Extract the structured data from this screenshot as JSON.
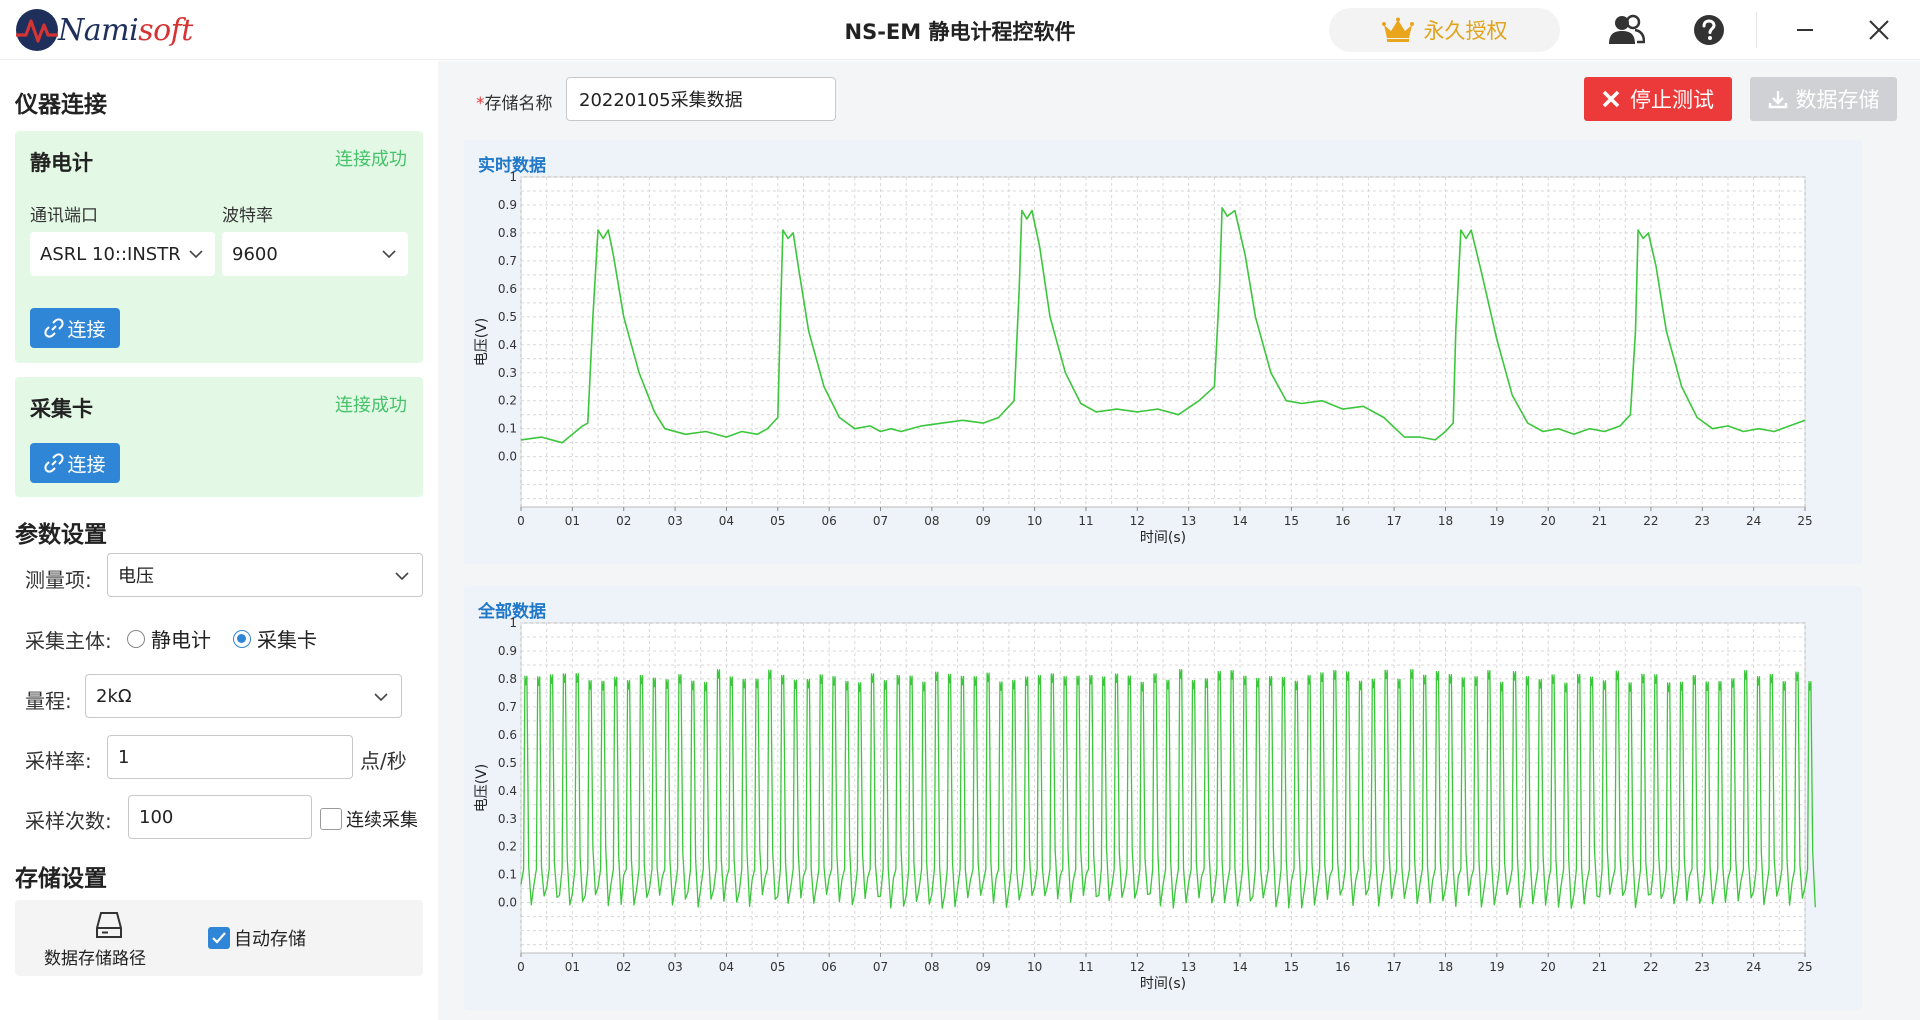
{
  "app": {
    "logo_text_a": "Nami",
    "logo_text_b": "soft",
    "title": "NS-EM 静电计程控软件",
    "license_label": "永久授权"
  },
  "left": {
    "section_connection": "仪器连接",
    "electrometer": {
      "title": "静电计",
      "status": "连接成功",
      "port_label": "通讯端口",
      "port_value": "ASRL 10::INSTR",
      "baud_label": "波特率",
      "baud_value": "9600",
      "connect_label": "连接"
    },
    "daq": {
      "title": "采集卡",
      "status": "连接成功",
      "connect_label": "连接"
    },
    "section_params": "参数设置",
    "params": {
      "measure_label": "测量项:",
      "measure_value": "电压",
      "subject_label": "采集主体:",
      "subject_opt1": "静电计",
      "subject_opt2": "采集卡",
      "subject_selected": "采集卡",
      "range_label": "量程:",
      "range_value": "2kΩ",
      "rate_label": "采样率:",
      "rate_value": "1",
      "rate_unit": "点/秒",
      "count_label": "采样次数:",
      "count_value": "100",
      "continuous_label": "连续采集",
      "continuous_checked": false
    },
    "section_storage": "存储设置",
    "storage": {
      "path_label": "数据存储路径",
      "auto_label": "自动存储",
      "auto_checked": true
    }
  },
  "top": {
    "name_label": "存储名称",
    "name_value": "20220105采集数据",
    "stop_label": "停止测试",
    "save_label": "数据存储"
  },
  "colors": {
    "accent": "#2f86d6",
    "success": "#46c26a",
    "danger": "#ec3a3a",
    "line": "#3cc63c",
    "license": "#e0a41d"
  },
  "chart_data": [
    {
      "type": "line",
      "title": "实时数据",
      "xlabel": "时间(s)",
      "ylabel": "电压(V)",
      "x_ticks": [
        "0",
        "01",
        "02",
        "03",
        "04",
        "05",
        "06",
        "07",
        "08",
        "09",
        "10",
        "11",
        "12",
        "13",
        "14",
        "15",
        "16",
        "17",
        "18",
        "19",
        "20",
        "21",
        "22",
        "23",
        "24",
        "25"
      ],
      "y_ticks": [
        "0.0",
        "0.1",
        "0.2",
        "0.3",
        "0.4",
        "0.5",
        "0.6",
        "0.7",
        "0.8",
        "0.9",
        "1"
      ],
      "xlim": [
        0,
        25
      ],
      "ylim": [
        -0.18,
        1.0
      ],
      "grid": true,
      "series": [
        {
          "x": [
            0,
            0.4,
            0.8,
            1.0,
            1.2,
            1.3,
            1.4,
            1.5,
            1.6,
            1.7,
            1.8,
            2.0,
            2.3,
            2.6,
            2.8,
            3.2,
            3.6,
            4.0,
            4.3,
            4.6,
            4.8,
            5.0,
            5.05,
            5.1,
            5.2,
            5.3,
            5.4,
            5.6,
            5.9,
            6.2,
            6.5,
            6.8,
            7.0,
            7.2,
            7.4,
            7.8,
            8.2,
            8.6,
            9.0,
            9.3,
            9.6,
            9.7,
            9.75,
            9.85,
            9.95,
            10.1,
            10.3,
            10.6,
            10.9,
            11.2,
            11.6,
            12.0,
            12.4,
            12.8,
            13.2,
            13.5,
            13.6,
            13.65,
            13.75,
            13.9,
            14.1,
            14.3,
            14.6,
            14.9,
            15.2,
            15.6,
            16.0,
            16.4,
            16.8,
            17.2,
            17.5,
            17.8,
            18.0,
            18.15,
            18.2,
            18.3,
            18.4,
            18.5,
            18.7,
            19.0,
            19.3,
            19.6,
            19.9,
            20.2,
            20.5,
            20.8,
            21.1,
            21.4,
            21.6,
            21.7,
            21.75,
            21.85,
            21.95,
            22.1,
            22.3,
            22.6,
            22.9,
            23.2,
            23.5,
            23.8,
            24.1,
            24.4,
            24.7,
            25.0
          ],
          "y": [
            0.06,
            0.07,
            0.05,
            0.08,
            0.11,
            0.12,
            0.5,
            0.81,
            0.78,
            0.81,
            0.72,
            0.5,
            0.3,
            0.16,
            0.1,
            0.08,
            0.09,
            0.07,
            0.09,
            0.08,
            0.1,
            0.14,
            0.5,
            0.81,
            0.78,
            0.8,
            0.68,
            0.45,
            0.25,
            0.14,
            0.1,
            0.11,
            0.09,
            0.1,
            0.09,
            0.11,
            0.12,
            0.13,
            0.12,
            0.14,
            0.2,
            0.6,
            0.88,
            0.85,
            0.88,
            0.75,
            0.5,
            0.3,
            0.19,
            0.16,
            0.17,
            0.16,
            0.17,
            0.15,
            0.2,
            0.25,
            0.6,
            0.89,
            0.86,
            0.88,
            0.72,
            0.5,
            0.3,
            0.2,
            0.19,
            0.2,
            0.17,
            0.18,
            0.14,
            0.07,
            0.07,
            0.06,
            0.09,
            0.12,
            0.45,
            0.81,
            0.78,
            0.81,
            0.66,
            0.42,
            0.22,
            0.12,
            0.09,
            0.1,
            0.08,
            0.1,
            0.09,
            0.11,
            0.15,
            0.45,
            0.81,
            0.78,
            0.8,
            0.68,
            0.45,
            0.25,
            0.14,
            0.1,
            0.11,
            0.09,
            0.1,
            0.09,
            0.11,
            0.13
          ]
        }
      ]
    },
    {
      "type": "line",
      "title": "全部数据",
      "xlabel": "时间(s)",
      "ylabel": "电压(V)",
      "x_ticks": [
        "0",
        "01",
        "02",
        "03",
        "04",
        "05",
        "06",
        "07",
        "08",
        "09",
        "10",
        "11",
        "12",
        "13",
        "14",
        "15",
        "16",
        "17",
        "18",
        "19",
        "20",
        "21",
        "22",
        "23",
        "24",
        "25"
      ],
      "y_ticks": [
        "0.0",
        "0.1",
        "0.2",
        "0.3",
        "0.4",
        "0.5",
        "0.6",
        "0.7",
        "0.8",
        "0.9",
        "1"
      ],
      "xlim": [
        0,
        25
      ],
      "ylim": [
        -0.18,
        1.0
      ],
      "grid": true,
      "series": [
        {
          "pattern": "dense periodic pulses between ~-0.02 V and ~0.82 V, about 4 pulses per second",
          "pulse_period_s": 0.25,
          "peak_value": 0.81,
          "base_value": 0.02
        }
      ]
    }
  ]
}
